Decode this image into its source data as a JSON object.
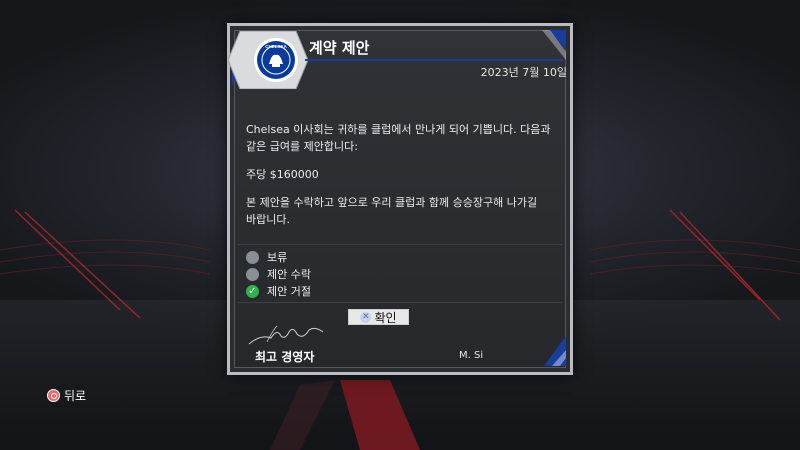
{
  "dialog": {
    "title": "계약 제안",
    "date": "2023년 7월 10일",
    "club_crest_text": "CHELSEA",
    "paragraph1_line1": "Chelsea 이사회는 귀하를 클럽에서 만나게 되어 기쁩니다. 다음과",
    "paragraph1_line2": "같은 급여를 제안합니다:",
    "salary": "주당 $160000",
    "paragraph2_line1": "본 제안을 수락하고 앞으로 우리 클럽과 함께 승승장구해 나가길",
    "paragraph2_line2": "바랍니다.",
    "options": [
      {
        "label": "보류",
        "checked": false
      },
      {
        "label": "제안 수락",
        "checked": false
      },
      {
        "label": "제안 거절",
        "checked": true
      }
    ],
    "confirm_label": "확인",
    "ceo_title": "최고 경영자",
    "ceo_name": "M. Si"
  },
  "footer": {
    "back_label": "뒤로"
  },
  "colors": {
    "accent_blue": "#1a3c9a",
    "checked_green": "#2fb24c",
    "back_icon_red": "#e86a6a"
  }
}
